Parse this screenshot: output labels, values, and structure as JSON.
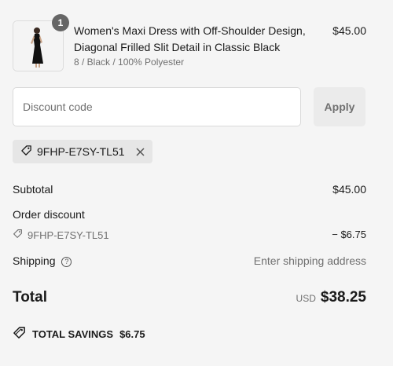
{
  "item": {
    "quantity": "1",
    "title": "Women's Maxi Dress with Off-Shoulder Design, Diagonal Frilled Slit Detail in Classic Black",
    "variant": "8 / Black / 100% Polyester",
    "price": "$45.00"
  },
  "discount": {
    "placeholder": "Discount code",
    "apply_label": "Apply",
    "applied_code": "9FHP-E7SY-TL51"
  },
  "summary": {
    "subtotal_label": "Subtotal",
    "subtotal_value": "$45.00",
    "order_discount_label": "Order discount",
    "discount_code": "9FHP-E7SY-TL51",
    "discount_value": "− $6.75",
    "shipping_label": "Shipping",
    "shipping_value": "Enter shipping address",
    "total_label": "Total",
    "currency": "USD",
    "total_value": "$38.25",
    "savings_label": "TOTAL SAVINGS",
    "savings_value": "$6.75"
  },
  "icons": {
    "tag": "tag-icon",
    "close": "close-icon",
    "help": "question-circle-icon",
    "savings": "tag-icon"
  }
}
